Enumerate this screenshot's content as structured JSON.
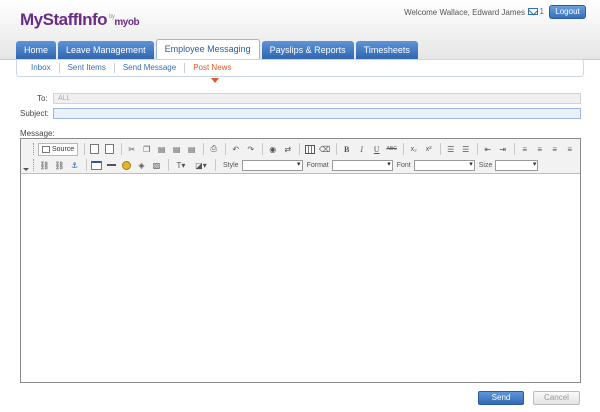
{
  "header": {
    "brand": "MyStaffInfo",
    "brand_by": "by",
    "brand_partner": "myob",
    "welcome_text": "Welcome Wallace, Edward James",
    "mail_count": "1",
    "logout_label": "Logout",
    "accent": "#3a6fb0",
    "brand_color": "#6b2c86"
  },
  "tabs": [
    {
      "label": "Home"
    },
    {
      "label": "Leave Management"
    },
    {
      "label": "Employee Messaging"
    },
    {
      "label": "Payslips & Reports"
    },
    {
      "label": "Timesheets"
    }
  ],
  "subnav": [
    {
      "label": "Inbox"
    },
    {
      "label": "Sent Items"
    },
    {
      "label": "Send Message"
    },
    {
      "label": "Post News"
    }
  ],
  "form": {
    "to_label": "To:",
    "to_value": "ALL",
    "subject_label": "Subject:",
    "subject_value": "",
    "message_label": "Message:"
  },
  "toolbar": {
    "source_label": "Source",
    "style_label": "Style",
    "format_label": "Format",
    "font_label": "Font",
    "size_label": "Size",
    "bold_glyph": "B",
    "italic_glyph": "I",
    "underline_glyph": "U",
    "strike_glyph": "ABC",
    "sub_glyph": "x₂",
    "sup_glyph": "x²"
  },
  "actions": {
    "send_label": "Send",
    "cancel_label": "Cancel"
  }
}
